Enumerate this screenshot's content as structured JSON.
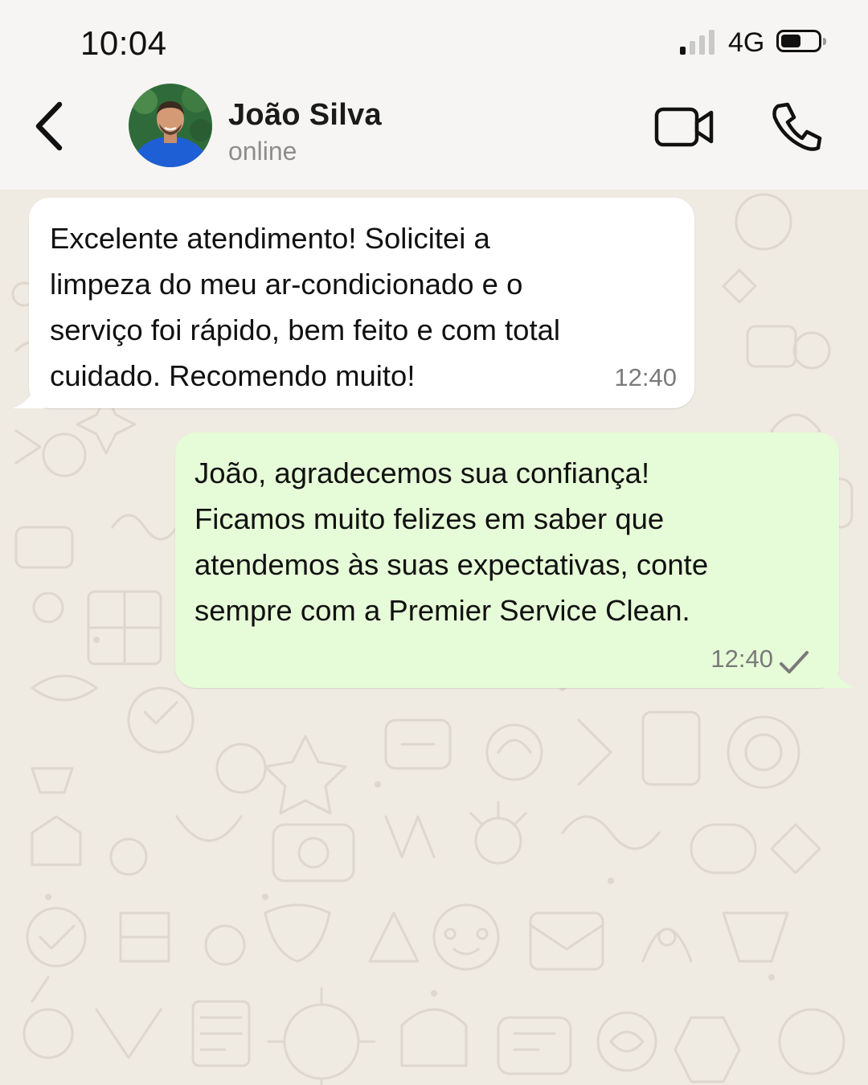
{
  "status_bar": {
    "time": "10:04",
    "network": "4G",
    "signal_bars_active": 1,
    "signal_bars_total": 4
  },
  "header": {
    "back_icon": "chevron-left-icon",
    "contact_name": "João Silva",
    "contact_status": "online",
    "video_icon": "video-camera-icon",
    "call_icon": "phone-icon"
  },
  "messages": [
    {
      "direction": "incoming",
      "text": "Excelente atendimento! Solicitei a\nlimpeza do meu ar-condicionado e o\nserviço foi rápido, bem feito e com total\ncuidado. Recomendo muito!",
      "time": "12:40"
    },
    {
      "direction": "outgoing",
      "text": "João, agradecemos sua confiança!\nFicamos muito felizes em saber que\natendemos às suas expectativas, conte\nsempre com a Premier Service Clean.",
      "time": "12:40",
      "status_icon": "single-check-icon"
    }
  ],
  "colors": {
    "chat_background": "#efeae2",
    "incoming_bubble": "#ffffff",
    "outgoing_bubble": "#e6fbd7",
    "header_background": "#f6f5f3"
  }
}
